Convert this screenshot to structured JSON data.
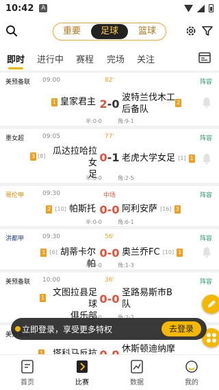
{
  "status_bar": {
    "time": "10:42",
    "app_icon": "A"
  },
  "header": {
    "segments": [
      "重要",
      "足球",
      "篮球"
    ],
    "active_segment": "足球"
  },
  "tabs": [
    {
      "label": "即时",
      "active": true
    },
    {
      "label": "进行中",
      "active": false
    },
    {
      "label": "赛程",
      "active": false
    },
    {
      "label": "完场",
      "active": false
    },
    {
      "label": "关注",
      "active": false
    }
  ],
  "matches": [
    {
      "league": "美预备联",
      "time": "09:00",
      "status": "82'",
      "lineup": "阵容",
      "home_badge": "1",
      "home_rank": "",
      "home": "皇家君主",
      "home_score": "2",
      "away_score": "0",
      "away": "波特兰伐木工\n后备队",
      "away_rank": "",
      "away_badge": "2",
      "half": "半:0-0",
      "corner": "角:9-1"
    },
    {
      "league": "墨女超",
      "time": "09:05",
      "status": "77'",
      "lineup": "阵容",
      "home_badge": "3",
      "home_rank": "[8]",
      "home": "瓜达拉哈拉女\n足",
      "home_score": "0",
      "away_score": "1",
      "away": "老虎大学女足",
      "away_rank": "[1]",
      "away_badge": "1",
      "half": "半:0-0",
      "corner": "角:2-5"
    },
    {
      "league": "哥伦甲",
      "time": "09:30",
      "status": "中场",
      "lineup": "阵容",
      "home_badge": "2",
      "home_rank": "[10]",
      "home": "帕斯托",
      "home_score": "0",
      "away_score": "0",
      "away": "阿利安萨",
      "away_rank": "[16]",
      "away_badge": "3",
      "half": "半:0-0",
      "corner": "角:6-1"
    },
    {
      "league": "洪都甲",
      "time": "09:30",
      "status": "56'",
      "lineup": "阵容",
      "home_badge": "1",
      "home_rank": "[6]",
      "home": "胡蒂卡尔帕",
      "home_score": "0",
      "away_score": "0",
      "away": "奥兰乔FC",
      "away_rank": "[10]",
      "away_badge": "1",
      "half": "半:0-0",
      "corner": "角:1-3"
    },
    {
      "league": "美预备联",
      "time": "10:00",
      "status": "36'",
      "lineup": "阵容",
      "home_badge": "1",
      "home_rank": "",
      "home": "文图拉县足球\n俱乐部",
      "home_score": "0",
      "away_score": "0",
      "away": "圣路易斯市B\n队",
      "away_rank": "",
      "away_badge": "",
      "half": "半:0-0",
      "corner": "角:2-2"
    },
    {
      "league": "美预备联",
      "time": "",
      "status": "",
      "lineup": "",
      "home_badge": "1",
      "home_rank": "",
      "home": "塔科马反抗者",
      "home_score": "0",
      "away_score": "0",
      "away": "休斯顿迪纳摩\nB队",
      "away_rank": "",
      "away_badge": "",
      "half": "",
      "corner": ""
    }
  ],
  "login_bar": {
    "message": "立即登录，享受更多特权",
    "button": "去登录"
  },
  "bottom_nav": [
    {
      "label": "首页",
      "icon": "home-icon"
    },
    {
      "label": "比赛",
      "icon": "match-icon"
    },
    {
      "label": "数据",
      "icon": "data-icon"
    },
    {
      "label": "我的",
      "icon": "profile-icon"
    }
  ],
  "colors": {
    "accent": "#f5b800",
    "score_red": "#e0503a",
    "lineup_green": "#2a9d6a"
  }
}
